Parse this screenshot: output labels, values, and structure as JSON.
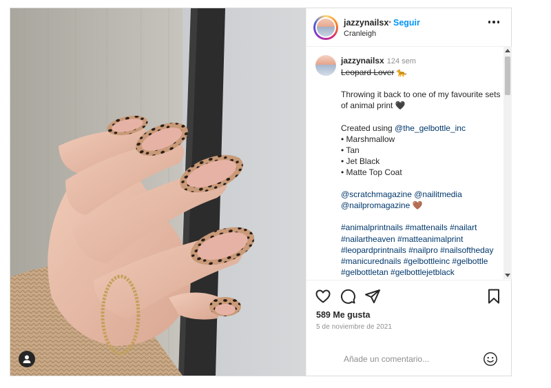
{
  "header": {
    "username": "jazzynailsx",
    "separator": "•",
    "follow_label": "Seguir",
    "location": "Cranleigh",
    "more_icon": "more-horizontal-icon"
  },
  "caption": {
    "username": "jazzynailsx",
    "time_ago": "124 sem",
    "title": "Leopard Lover",
    "title_emoji": "🐆",
    "line1": "Throwing it back to one of my favourite sets of animal print 🖤",
    "created_prefix": "Created using ",
    "created_mention": "@the_gelbottle_inc",
    "items": [
      "• Marshmallow",
      "• Tan",
      "• Jet Black",
      "• Matte Top Coat"
    ],
    "mentions": "@scratchmagazine @nailitmedia @nailpromagazine",
    "mentions_emoji": "🤎",
    "hashtags": "#animalprintnails #mattenails #nailart #nailartheaven #matteanimalprint #leopardprintnails #nailpro #nailsoftheday #manicurednails #gelbottleinc #gelbottle #gelbottletan #gelbottlejetblack #gelbottlemarshmallow"
  },
  "actions": {
    "icons": [
      "heart-icon",
      "comment-icon",
      "share-icon",
      "bookmark-icon"
    ],
    "likes": "589 Me gusta",
    "date": "5 de noviembre de 2021",
    "comment_placeholder": "Añade un comentario...",
    "emoji_icon": "emoji-icon"
  },
  "photo": {
    "user_tag_icon": "user-tag-icon"
  },
  "colors": {
    "link_blue": "#0095f6",
    "mention_dark": "#00376b",
    "muted": "#8e8e8e",
    "nail_pink": "#e7b2a6",
    "nail_print": "#2a1d17"
  }
}
